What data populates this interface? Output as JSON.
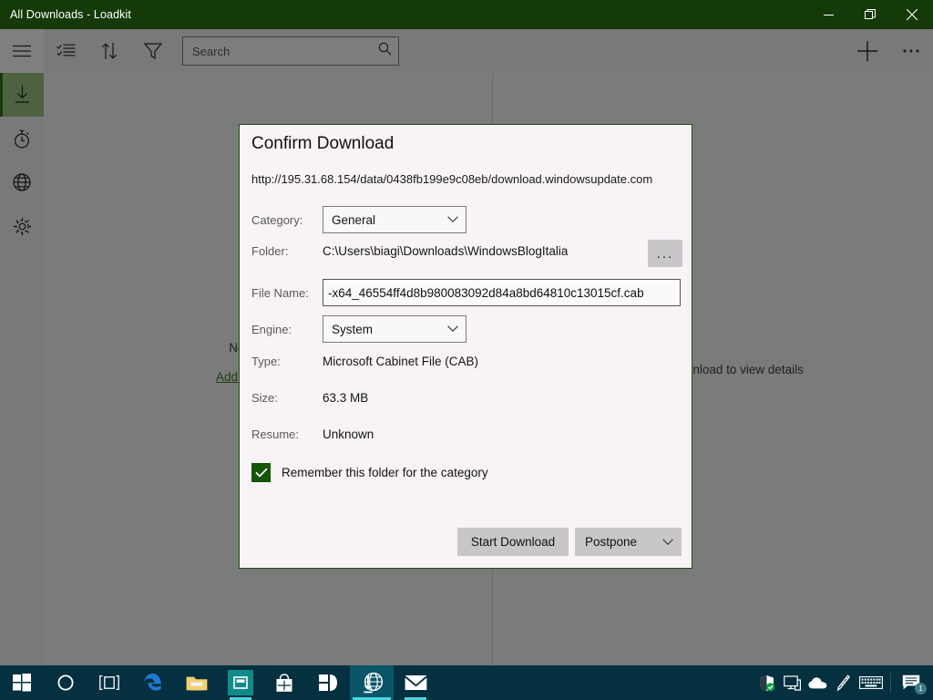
{
  "window": {
    "title": "All Downloads - Loadkit",
    "accent_green": "#143a08",
    "controls": {
      "minimize": "minimize-button",
      "maximize": "maximize-button",
      "close": "close-button"
    }
  },
  "toolbar": {
    "menu_label": "Menu",
    "select_label": "Select",
    "sort_label": "Sort",
    "filter_label": "Filter",
    "add_label": "Add",
    "more_label": "More",
    "search_placeholder": "Search",
    "search_value": ""
  },
  "sidebar": {
    "items": [
      {
        "label": "Downloads",
        "icon": "download-icon",
        "active": true
      },
      {
        "label": "History",
        "icon": "clock-icon",
        "active": false
      },
      {
        "label": "Browser",
        "icon": "globe-icon",
        "active": false
      },
      {
        "label": "Settings",
        "icon": "gear-icon",
        "active": false
      }
    ]
  },
  "content": {
    "empty_message": "No downloads",
    "empty_link": "Add new download",
    "detail_message": "Select a download to view details"
  },
  "dialog": {
    "title": "Confirm Download",
    "url": "http://195.31.68.154/data/0438fb199e9c08eb/download.windowsupdate.com",
    "fields": {
      "category_label": "Category:",
      "category_value": "General",
      "folder_label": "Folder:",
      "folder_value": "C:\\Users\\biagi\\Downloads\\WindowsBlogItalia",
      "browse_label": "...",
      "filename_label": "File Name:",
      "filename_value": "-x64_46554ff4d8b980083092d84a8bd64810c13015cf.cab",
      "engine_label": "Engine:",
      "engine_value": "System",
      "type_label": "Type:",
      "type_value": "Microsoft Cabinet File (CAB)",
      "size_label": "Size:",
      "size_value": "63.3 MB",
      "resume_label": "Resume:",
      "resume_value": "Unknown"
    },
    "remember_checkbox": {
      "label": "Remember this folder for the category",
      "checked": true,
      "color": "#155508"
    },
    "buttons": {
      "start": "Start Download",
      "postpone": "Postpone"
    }
  },
  "taskbar": {
    "items": [
      {
        "name": "start-button",
        "icon": "windows-logo-icon"
      },
      {
        "name": "cortana-button",
        "icon": "circle-icon"
      },
      {
        "name": "task-view-button",
        "icon": "task-view-icon"
      },
      {
        "name": "edge-button",
        "icon": "edge-icon"
      },
      {
        "name": "file-explorer-button",
        "icon": "folder-icon"
      },
      {
        "name": "store-app-button",
        "icon": "teal-app-icon"
      },
      {
        "name": "microsoft-store-button",
        "icon": "shopping-bag-icon"
      },
      {
        "name": "office-button",
        "icon": "office-icon"
      },
      {
        "name": "loadkit-button",
        "icon": "download-globe-icon"
      },
      {
        "name": "mail-button",
        "icon": "envelope-icon"
      }
    ],
    "tray": [
      {
        "name": "windows-defender-tray-icon",
        "icon": "shield-icon"
      },
      {
        "name": "display-tray-icon",
        "icon": "monitor-icon"
      },
      {
        "name": "onedrive-tray-icon",
        "icon": "cloud-icon"
      },
      {
        "name": "pen-tray-icon",
        "icon": "pen-icon"
      },
      {
        "name": "keyboard-tray-icon",
        "icon": "keyboard-icon"
      },
      {
        "name": "action-center-button",
        "icon": "notification-icon",
        "badge": "1"
      }
    ]
  }
}
